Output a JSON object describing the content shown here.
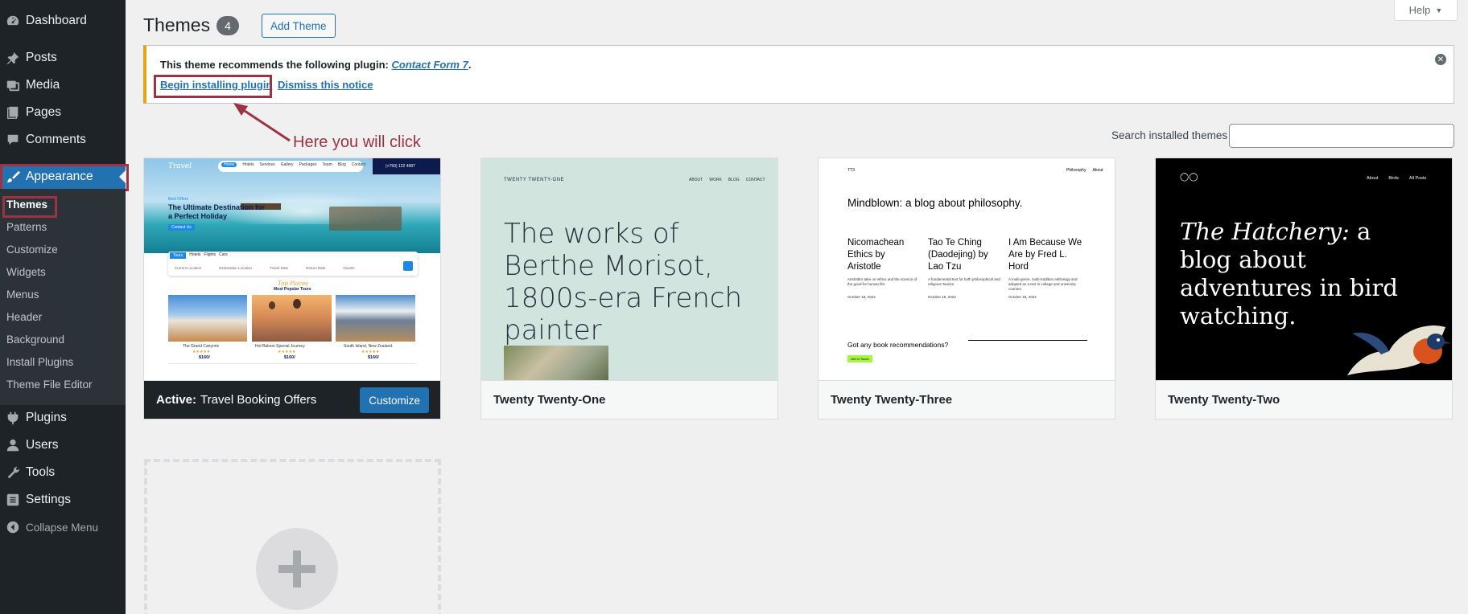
{
  "sidebar": {
    "items": [
      {
        "label": "Dashboard",
        "icon": "dashboard-icon"
      },
      {
        "label": "Posts",
        "icon": "pin-icon"
      },
      {
        "label": "Media",
        "icon": "media-icon"
      },
      {
        "label": "Pages",
        "icon": "pages-icon"
      },
      {
        "label": "Comments",
        "icon": "comment-icon"
      },
      {
        "label": "Appearance",
        "icon": "brush-icon"
      },
      {
        "label": "Plugins",
        "icon": "plugin-icon"
      },
      {
        "label": "Users",
        "icon": "user-icon"
      },
      {
        "label": "Tools",
        "icon": "wrench-icon"
      },
      {
        "label": "Settings",
        "icon": "settings-icon"
      }
    ],
    "submenu": [
      "Themes",
      "Patterns",
      "Customize",
      "Widgets",
      "Menus",
      "Header",
      "Background",
      "Install Plugins",
      "Theme File Editor"
    ],
    "collapse_label": "Collapse Menu"
  },
  "header": {
    "title": "Themes",
    "count": "4",
    "add_button": "Add Theme",
    "help": "Help"
  },
  "notice": {
    "text": "This theme recommends the following plugin:",
    "plugin_link": "Contact Form 7",
    "period": ".",
    "begin_link": "Begin installing plugin",
    "dismiss_link": "Dismiss this notice"
  },
  "annotation": {
    "text": "Here you will click",
    "color": "#9b3342"
  },
  "search": {
    "label": "Search installed themes",
    "value": ""
  },
  "themes": {
    "active": {
      "prefix": "Active:",
      "name": "Travel Booking Offers",
      "customize": "Customize",
      "preview": {
        "logo": "Travel",
        "nav": [
          "Home",
          "Hotels",
          "Services",
          "Gallery",
          "Packages",
          "Team",
          "Blog",
          "Contact"
        ],
        "phone": "(+750) 122 4687",
        "hero_small": "Best Offers",
        "hero": "The Ultimate Destination for a Perfect Holiday",
        "cta": "Contact Us",
        "tabs": [
          "Tours",
          "Hotels",
          "Flights",
          "Cars"
        ],
        "fields": [
          "Current Location",
          "Destination Location",
          "Travel Date",
          "Return Date",
          "Guests"
        ],
        "section_script": "Top Places",
        "section_title": "Most Popular Tours",
        "tours": [
          {
            "name": "The Grand Canyons",
            "price": "$160/"
          },
          {
            "name": "Hot Baloon Special Journey",
            "price": "$160/"
          },
          {
            "name": "South Island, New Zealand.",
            "price": "$160/"
          }
        ]
      }
    },
    "twenty_one": {
      "name": "Twenty Twenty-One",
      "preview": {
        "site": "TWENTY TWENTY-ONE",
        "nav": [
          "ABOUT",
          "WORK",
          "BLOG",
          "CONTACT"
        ],
        "headline": "The works of Berthe Morisot, 1800s-era French painter"
      }
    },
    "twenty_three": {
      "name": "Twenty Twenty-Three",
      "preview": {
        "site": "TT3",
        "nav": [
          "Philosophy",
          "About"
        ],
        "headline": "Mindblown: a blog about philosophy.",
        "posts": [
          {
            "title": "Nicomachean Ethics by Aristotle",
            "excerpt": "Aristotle's take on ethics and the science of the good for human life.",
            "date": "October 18, 2022"
          },
          {
            "title": "Tao Te Ching (Daodejing) by Lao Tzu",
            "excerpt": "A fundamental text for both philosophical and religious Taoism.",
            "date": "October 18, 2022"
          },
          {
            "title": "I Am Because We Are by Fred L. Hord",
            "excerpt": "A multi-genre, multi-tradition anthology and adopted as a text in college and university courses.",
            "date": "October 18, 2022"
          }
        ],
        "cta_question": "Got any book recommendations?",
        "cta_button": "Get In Touch"
      }
    },
    "twenty_two": {
      "name": "Twenty Twenty-Two",
      "preview": {
        "nav": [
          "About",
          "Birds",
          "All Posts"
        ],
        "headline_italic": "The Hatchery:",
        "headline_rest": "a blog about adventures in bird watching."
      }
    }
  },
  "colors": {
    "sidebar_bg": "#1d2327",
    "accent": "#2271b1",
    "notice_border": "#dba617",
    "annotation": "#9b3342"
  }
}
